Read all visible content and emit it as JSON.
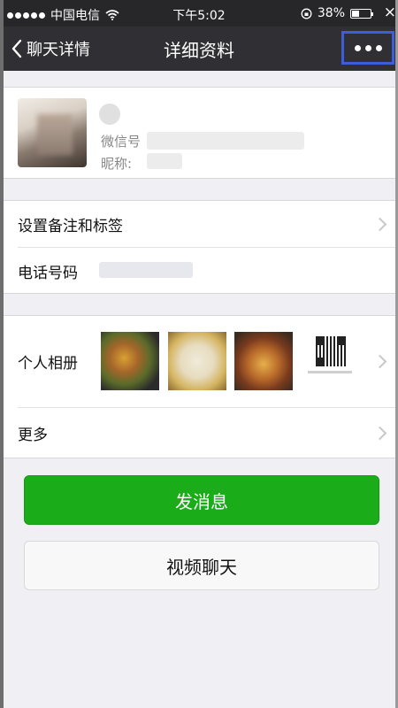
{
  "status_bar": {
    "carrier": "中国电信",
    "time": "下午5:02",
    "battery": "38%",
    "battery_level": 0.38,
    "close_glyph": "×"
  },
  "nav": {
    "back_label": "聊天详情",
    "title": "详细资料",
    "more_icon": "ellipsis-icon"
  },
  "profile": {
    "wechat_id_label": "微信号",
    "nickname_label": "昵称:"
  },
  "rows": {
    "remark_tags": "设置备注和标签",
    "phone": "电话号码",
    "album": "个人相册",
    "more": "更多"
  },
  "buttons": {
    "send_message": "发消息",
    "video_call": "视频聊天"
  },
  "colors": {
    "primary_green": "#1aad19",
    "nav_bg": "#303034",
    "highlight_border": "#3b5fd8"
  }
}
